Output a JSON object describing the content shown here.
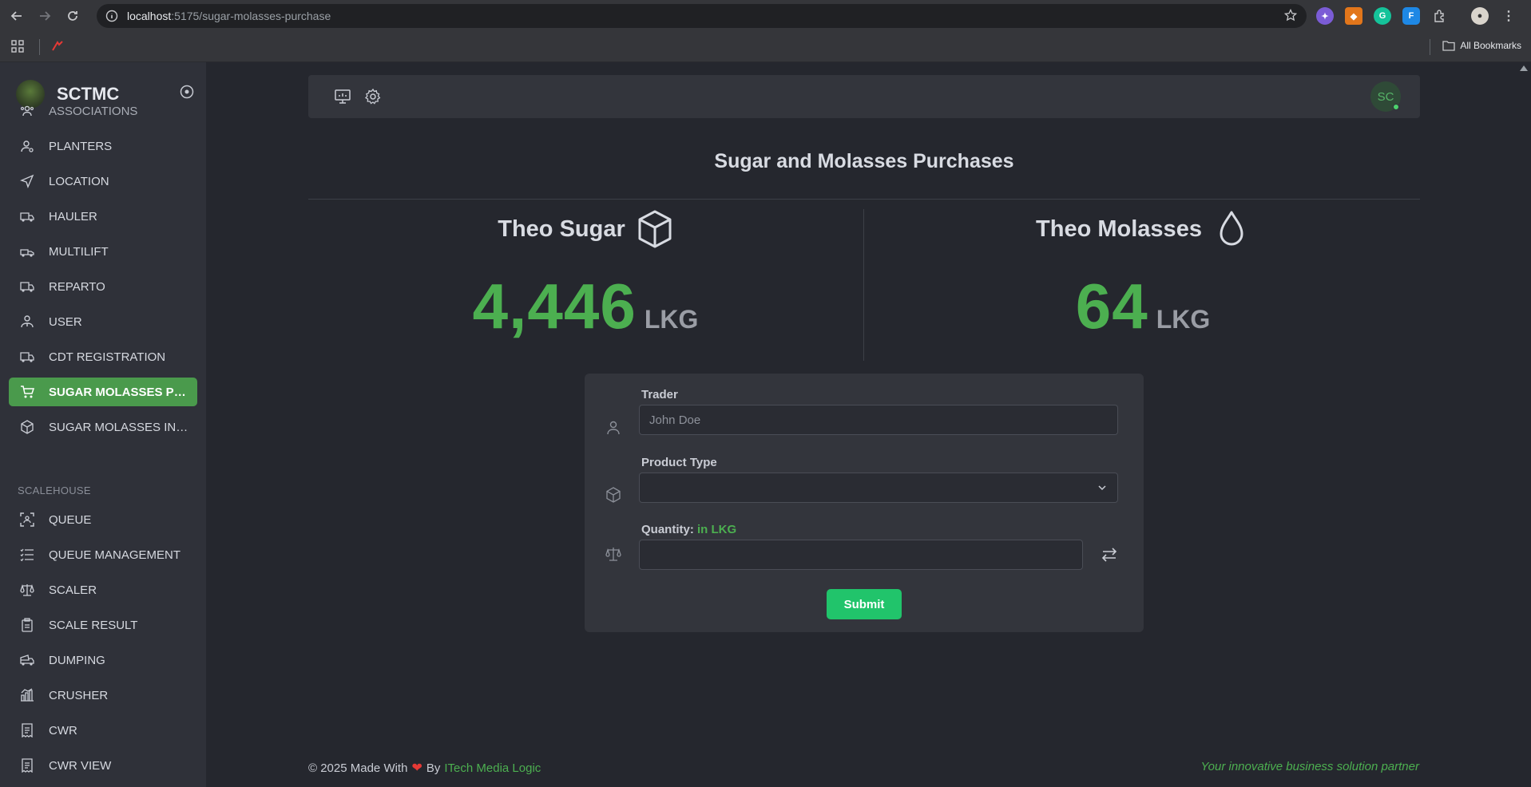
{
  "browser": {
    "url_host": "localhost",
    "url_path": ":5175/sugar-molasses-purchase",
    "all_bookmarks": "All Bookmarks"
  },
  "brand": {
    "name": "SCTMC"
  },
  "sidebar": {
    "items": [
      {
        "label": "ASSOCIATIONS",
        "icon": "users-icon"
      },
      {
        "label": "PLANTERS",
        "icon": "user-icon"
      },
      {
        "label": "LOCATION",
        "icon": "send-icon"
      },
      {
        "label": "HAULER",
        "icon": "truck-icon"
      },
      {
        "label": "MULTILIFT",
        "icon": "truck-icon"
      },
      {
        "label": "REPARTO",
        "icon": "truck-icon"
      },
      {
        "label": "USER",
        "icon": "user-tie-icon"
      },
      {
        "label": "CDT REGISTRATION",
        "icon": "truck-icon"
      },
      {
        "label": "SUGAR MOLASSES PURCHASE",
        "icon": "cart-icon"
      },
      {
        "label": "SUGAR MOLASSES INVENTORY",
        "icon": "box-icon"
      }
    ],
    "section_scalehouse": "SCALEHOUSE",
    "scale_items": [
      {
        "label": "QUEUE",
        "icon": "scan-icon"
      },
      {
        "label": "QUEUE MANAGEMENT",
        "icon": "list-icon"
      },
      {
        "label": "SCALER",
        "icon": "scale-icon"
      },
      {
        "label": "SCALE RESULT",
        "icon": "clipboard-icon"
      },
      {
        "label": "DUMPING",
        "icon": "dump-truck-icon"
      },
      {
        "label": "CRUSHER",
        "icon": "crusher-icon"
      },
      {
        "label": "CWR",
        "icon": "receipt-icon"
      },
      {
        "label": "CWR VIEW",
        "icon": "receipt-icon"
      }
    ]
  },
  "topbar": {
    "avatar_initials": "SC"
  },
  "page": {
    "title": "Sugar and Molasses Purchases",
    "sugar": {
      "label": "Theo Sugar",
      "value": "4,446",
      "unit": "LKG"
    },
    "molasses": {
      "label": "Theo Molasses",
      "value": "64",
      "unit": "LKG"
    }
  },
  "form": {
    "trader_label": "Trader",
    "trader_placeholder": "John Doe",
    "trader_value": "",
    "product_label": "Product Type",
    "product_value": "",
    "quantity_label": "Quantity:",
    "quantity_unit": "in LKG",
    "quantity_value": "",
    "submit_label": "Submit"
  },
  "footer": {
    "copyright": "© 2025 Made With",
    "by": "By",
    "company": "ITech Media Logic",
    "tagline": "Your innovative business solution partner"
  },
  "colors": {
    "accent": "#4caf50",
    "active": "#4a9a4c",
    "submit": "#21c46b"
  }
}
